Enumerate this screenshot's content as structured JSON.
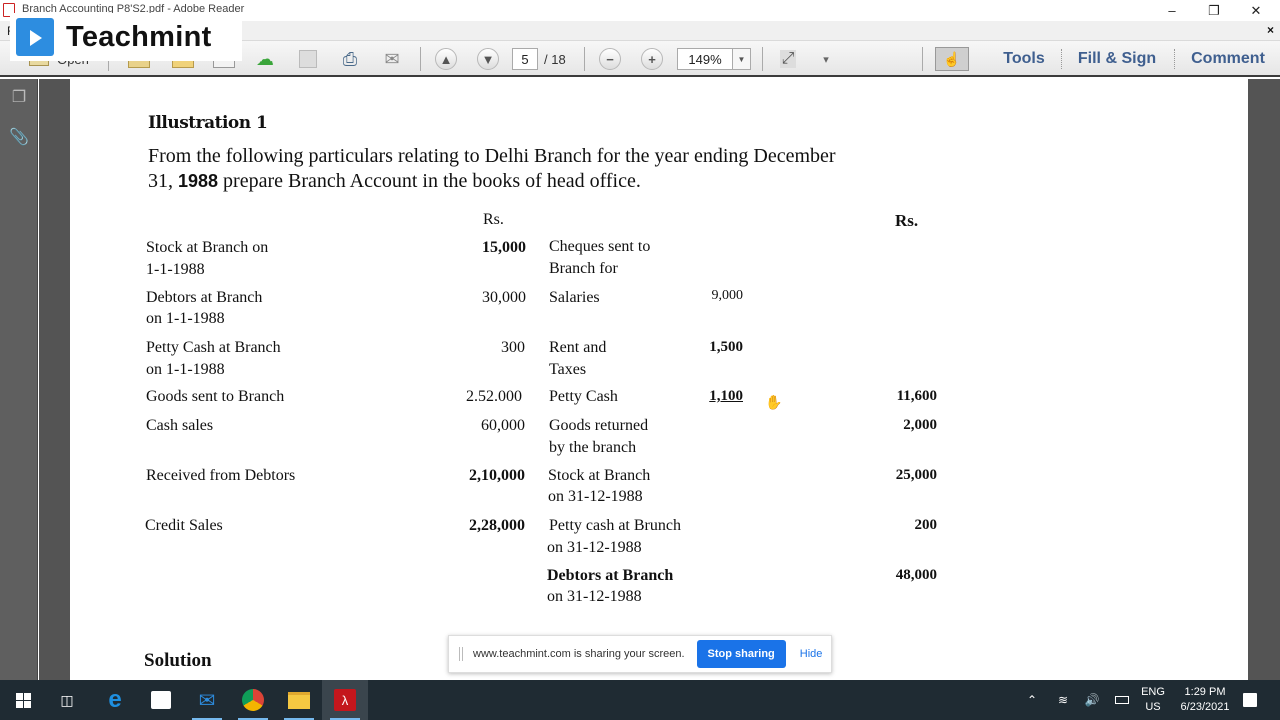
{
  "window": {
    "title": "Branch Accounting P8'S2.pdf - Adobe Reader",
    "menu_first": "F",
    "minimize_icon": "minimize-icon",
    "maximize_icon": "restore-icon",
    "close_icon": "close-icon",
    "close_doc_symbol": "×"
  },
  "overlay_logo": {
    "name": "Teachmint"
  },
  "toolbar": {
    "open_label": "Open",
    "page_current": "5",
    "page_total": "/ 18",
    "zoom_value": "149%",
    "tabs": [
      {
        "label": "Tools"
      },
      {
        "label": "Fill & Sign"
      },
      {
        "label": "Comment"
      }
    ],
    "icons": {
      "prev_page": "▲",
      "next_page": "▼",
      "zoom_out": "−",
      "zoom_in": "+",
      "dropdown": "▼",
      "fullscreen": "⤢",
      "more": "▾",
      "hand": "☝"
    }
  },
  "document": {
    "heading": "Illustration 1",
    "intro_line1": "From the following particulars relating to Delhi Branch for the year ending December",
    "intro_line2_pre": "31,",
    "intro_line2_year": "1988",
    "intro_line2_post": "prepare Branch Account in the books of head office.",
    "currency_left": "Rs.",
    "currency_right": "Rs.",
    "left_items": [
      {
        "line1": "Stock at Branch on",
        "line2": "1-1-1988",
        "amount": "15,000"
      },
      {
        "line1": "Debtors at Branch",
        "line2": "on 1-1-1988",
        "amount": "30,000"
      },
      {
        "line1": "Petty Cash at Branch",
        "line2": "on 1-1-1988",
        "amount": "300"
      },
      {
        "line1": "Goods sent to Branch",
        "line2": "",
        "amount": "2.52.000"
      },
      {
        "line1": "Cash sales",
        "line2": "",
        "amount": "60,000"
      },
      {
        "line1": "Received from Debtors",
        "line2": "",
        "amount": "2,10,000"
      },
      {
        "line1": "Credit Sales",
        "line2": "",
        "amount": "2,28,000"
      }
    ],
    "right_items": [
      {
        "line1": "Cheques sent to",
        "line2": "Branch for",
        "sub_amount": "",
        "amount": ""
      },
      {
        "line1": "Salaries",
        "line2": "",
        "sub_amount": "9,000",
        "amount": ""
      },
      {
        "line1": "Rent and",
        "line2": "Taxes",
        "sub_amount": "1,500",
        "amount": ""
      },
      {
        "line1": "Petty Cash",
        "line2": "",
        "sub_amount": "1,100",
        "amount": "11,600"
      },
      {
        "line1": "Goods returned",
        "line2": "by the branch",
        "sub_amount": "",
        "amount": "2,000"
      },
      {
        "line1": "Stock at Branch",
        "line2": "on 31-12-1988",
        "sub_amount": "",
        "amount": "25,000"
      },
      {
        "line1": "Petty cash at Brunch",
        "line2": "on 31-12-1988",
        "sub_amount": "",
        "amount": "200"
      },
      {
        "line1": "Debtors at Branch",
        "line2": "on 31-12-1988",
        "sub_amount": "",
        "amount": "48,000"
      }
    ],
    "solution_heading": "Solution"
  },
  "share_bar": {
    "message": "www.teachmint.com is sharing your screen.",
    "stop_label": "Stop sharing",
    "hide_label": "Hide"
  },
  "taskbar": {
    "apps": [
      "start",
      "task-view",
      "edge",
      "store",
      "mail",
      "chrome",
      "file-explorer",
      "adobe-reader"
    ],
    "lang_line1": "ENG",
    "lang_line2": "US",
    "time": "1:29 PM",
    "date": "6/23/2021"
  }
}
